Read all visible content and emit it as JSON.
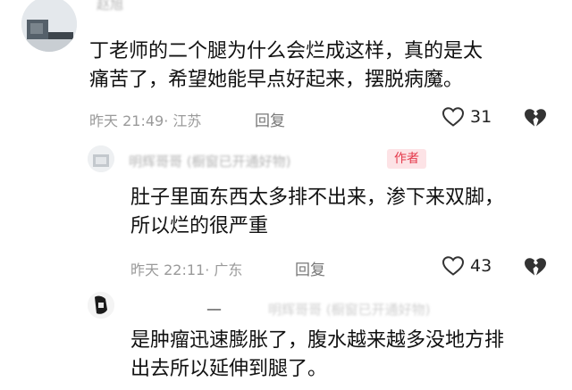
{
  "main_comment": {
    "username": "赵旭",
    "text_line1": "丁老师的二个腿为什么会烂成这样，真的是太",
    "text_line2": "痛苦了，希望她能早点好起来，摆脱病魔。",
    "time": "昨天 21:49",
    "location": "· 江苏",
    "reply_label": "回复",
    "likes": "31",
    "icons": [
      "heart-icon",
      "broken-heart-icon"
    ]
  },
  "reply_1": {
    "username": "明辉哥哥 (橱窗已开通好物)",
    "author_badge": "作者",
    "text_line1": "肚子里面东西太多排不出来，渗下来双脚，",
    "text_line2": "所以烂的很严重",
    "time": "昨天 22:11",
    "location": "· 广东",
    "reply_label": "回复",
    "likes": "43",
    "icons": [
      "heart-icon",
      "broken-heart-icon"
    ]
  },
  "reply_2": {
    "username_prefix": "__",
    "username": "明辉哥哥 (橱窗已开通好物)",
    "text_line1": "是肿瘤迅速膨胀了，腹水越来越多没地方排",
    "text_line2": "出去所以延伸到腿了。"
  },
  "colors": {
    "meta": "#9a9a9a",
    "badge_bg": "#fde3e6",
    "badge_text": "#e4394b",
    "text": "#111111"
  }
}
